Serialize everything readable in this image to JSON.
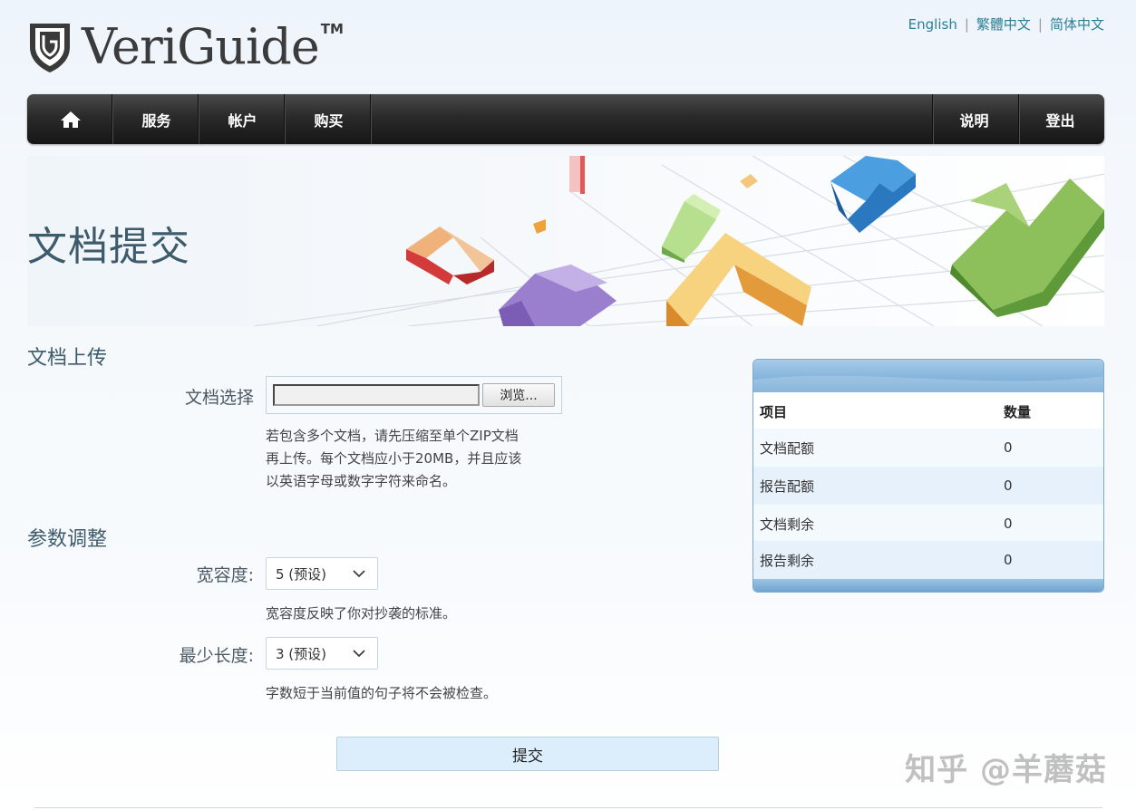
{
  "brand": {
    "name": "VeriGuide",
    "tm": "TM"
  },
  "languages": [
    "English",
    "繁體中文",
    "简体中文"
  ],
  "nav": {
    "left": [
      "服务",
      "帐户",
      "购买"
    ],
    "right": [
      "说明",
      "登出"
    ]
  },
  "page": {
    "title": "文档提交"
  },
  "upload": {
    "heading": "文档上传",
    "label": "文档选择",
    "browse": "浏览...",
    "hint": [
      "若包含多个文档，请先压缩至单个ZIP文档",
      "再上传。每个文档应小于20MB，并且应该",
      "以英语字母或数字字符来命名。"
    ]
  },
  "params": {
    "heading": "参数调整",
    "tolerance": {
      "label": "宽容度:",
      "value": "5 (预设)",
      "hint": "宽容度反映了你对抄袭的标准。"
    },
    "min_length": {
      "label": "最少长度:",
      "value": "3 (预设)",
      "hint": "字数短于当前值的句子将不会被检查。"
    }
  },
  "submit": "提交",
  "quota": {
    "header": [
      "项目",
      "数量"
    ],
    "rows": [
      [
        "文档配额",
        "0"
      ],
      [
        "报告配额",
        "0"
      ],
      [
        "文档剩余",
        "0"
      ],
      [
        "报告剩余",
        "0"
      ]
    ]
  },
  "watermark": "知乎 @羊蘑菇",
  "colors": {
    "accent": "#3d5b6b",
    "link": "#2a7f96",
    "nav": "#1e1e1e",
    "table_head": "#86b5dc"
  },
  "icons": {
    "home": "home-icon",
    "chevron": "chevron-down-icon",
    "logo": "shield-logo-icon"
  }
}
